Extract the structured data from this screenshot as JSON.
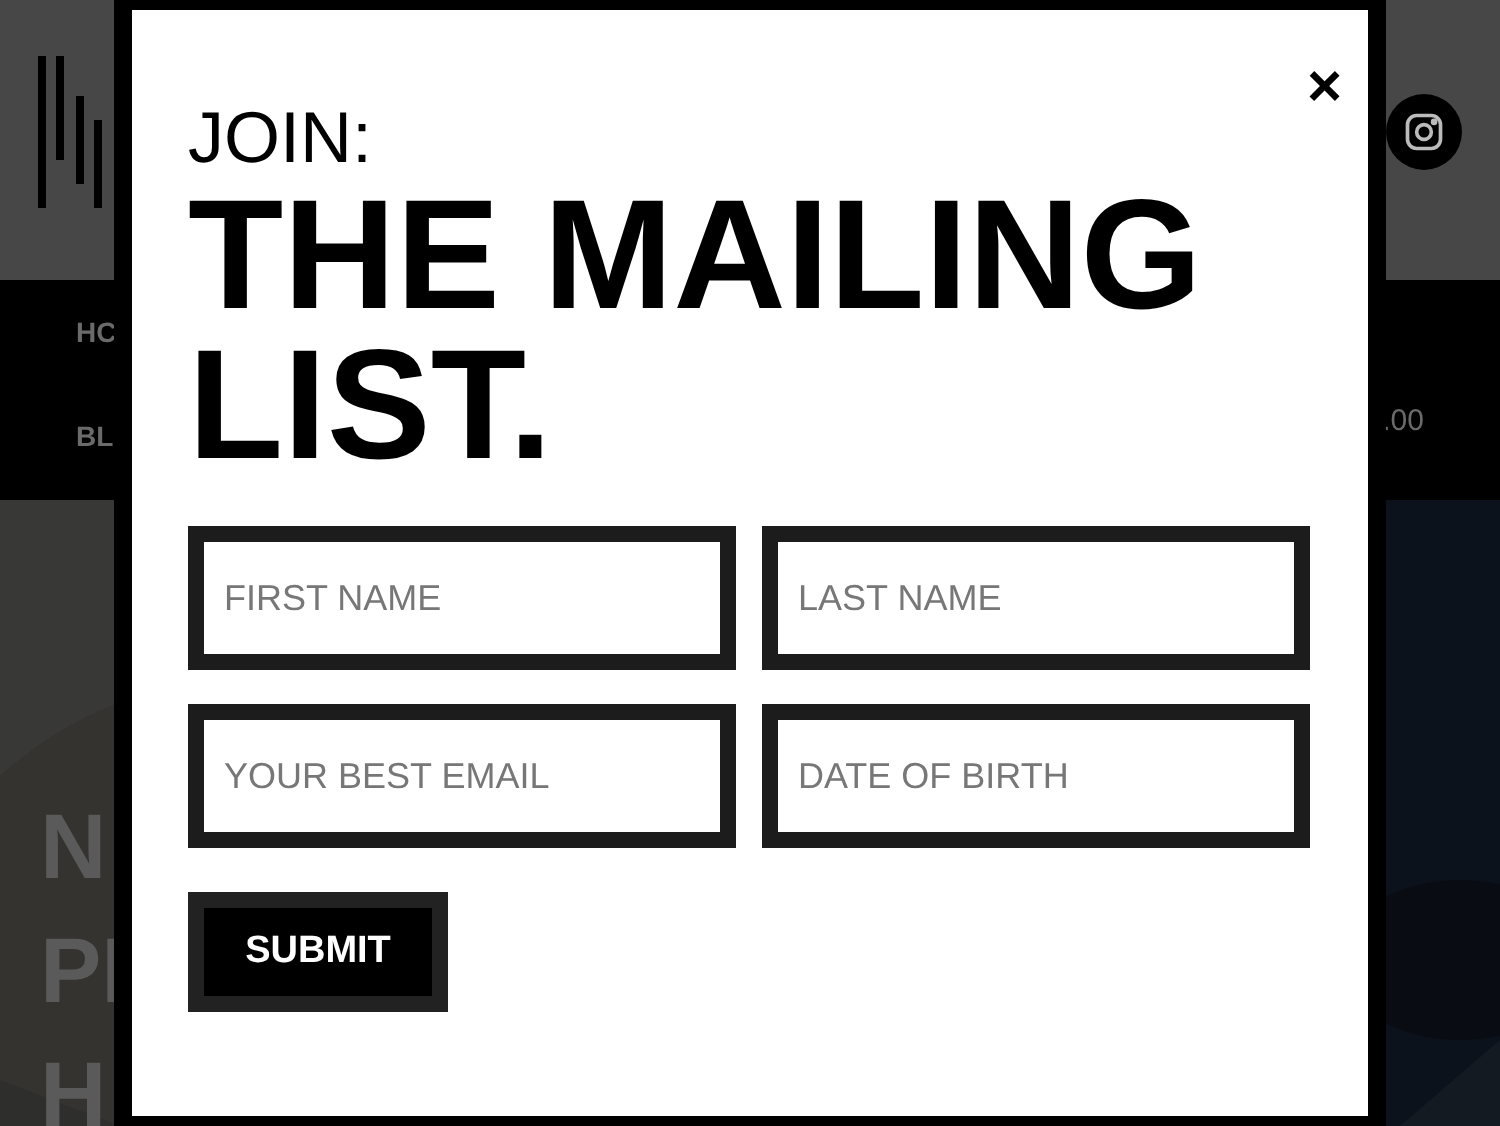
{
  "background": {
    "nav_items": [
      "HC",
      "BL"
    ],
    "price": ".00",
    "hero_lines": [
      "N",
      "PI",
      "H"
    ]
  },
  "modal": {
    "close": "×",
    "kicker": "JOIN:",
    "title": "THE MAILING LIST.",
    "fields": [
      {
        "placeholder": "FIRST NAME"
      },
      {
        "placeholder": "LAST NAME"
      },
      {
        "placeholder": "YOUR BEST EMAIL"
      },
      {
        "placeholder": "DATE OF BIRTH"
      }
    ],
    "submit": "SUBMIT"
  }
}
